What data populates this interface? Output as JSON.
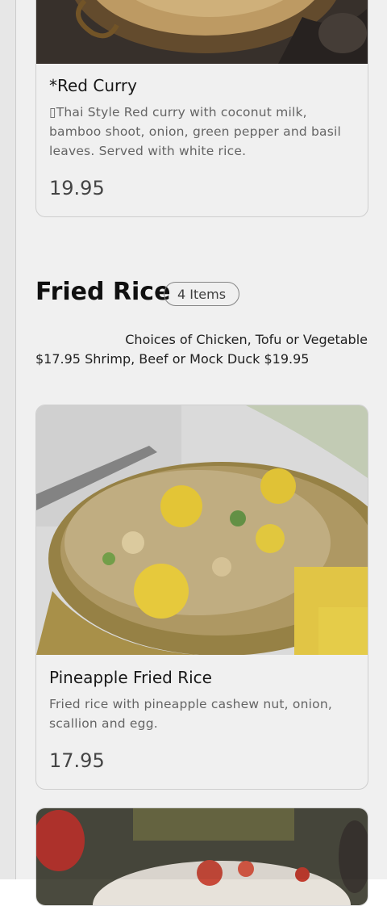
{
  "items_top": {
    "red_curry": {
      "name": "*Red Curry",
      "description": "▯Thai Style Red curry with coconut milk, bamboo shoot, onion, green pepper and basil leaves. Served with white rice.",
      "price": "19.95"
    }
  },
  "section": {
    "title": "Fried Rice",
    "count": "4 Items",
    "desc_line1": "Choices of Chicken, Tofu or Vegetable",
    "desc_line2": "$17.95 Shrimp, Beef or Mock Duck $19.95"
  },
  "items": [
    {
      "name": "Pineapple Fried Rice",
      "description": "Fried rice with pineapple cashew nut, onion, scallion and egg.",
      "price": "17.95"
    }
  ]
}
